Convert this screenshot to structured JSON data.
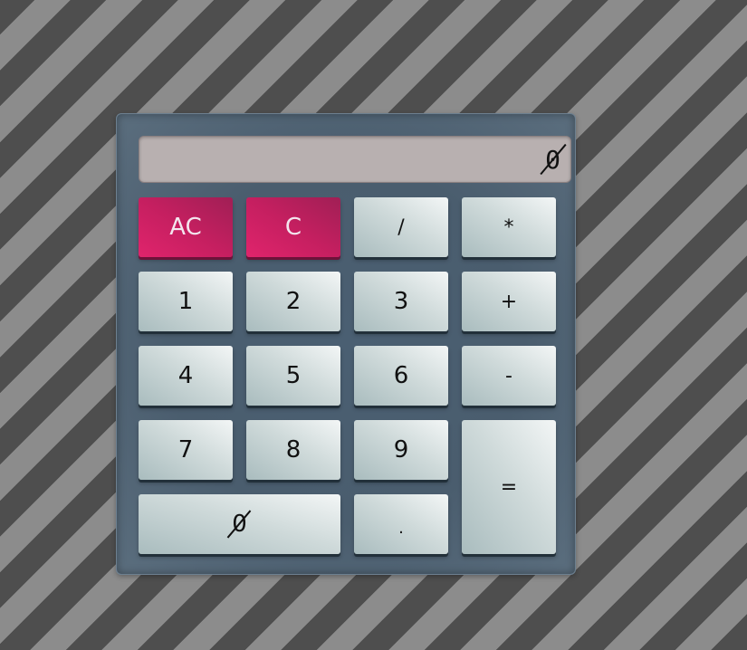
{
  "display": {
    "value": "0"
  },
  "keys": {
    "all_clear": "AC",
    "clear": "C",
    "divide": "/",
    "multiply": "*",
    "one": "1",
    "two": "2",
    "three": "3",
    "add": "+",
    "four": "4",
    "five": "5",
    "six": "6",
    "subtract": "-",
    "seven": "7",
    "eight": "8",
    "nine": "9",
    "equals": "=",
    "zero": "0",
    "decimal": "."
  },
  "colors": {
    "clear_accent": "#c51f60",
    "display_background": "#b8b0b0",
    "body": "#4a5d6e"
  }
}
